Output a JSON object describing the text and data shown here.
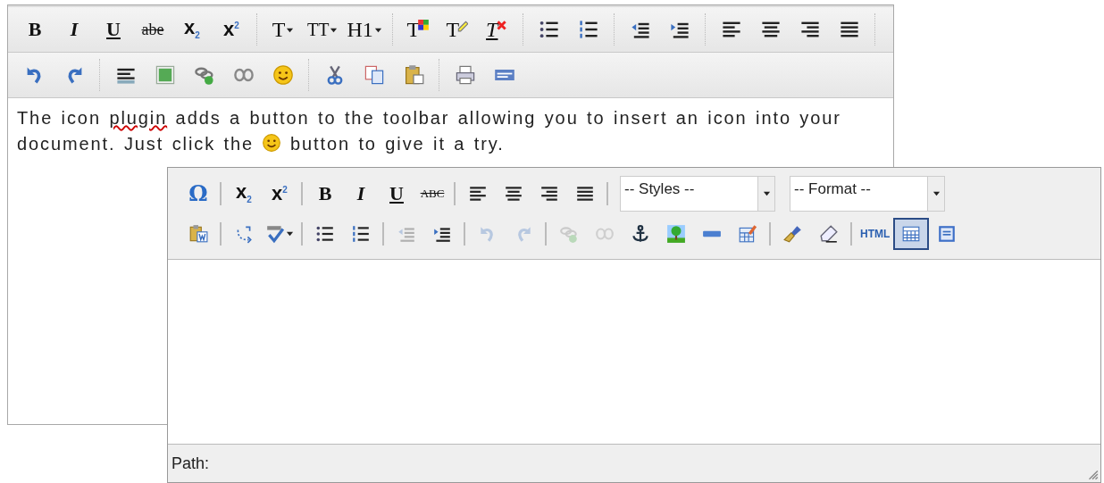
{
  "editor_back": {
    "toolbar_labels": [
      "B",
      "I",
      "U",
      "abe",
      "x$_{2}$",
      "x$^{2}$",
      "T",
      "TT",
      "H1",
      "T",
      "T",
      "T"
    ],
    "content_lines": [
      [
        {
          "kind": "text",
          "text": "The icon "
        },
        {
          "kind": "misspelled",
          "text": "plugin"
        },
        {
          "kind": "text",
          "text": " adds a button to the toolbar allowing you to insert an icon into your"
        }
      ],
      [
        {
          "kind": "text",
          "text": "document. Just click the "
        },
        {
          "kind": "icon"
        },
        {
          "kind": "text",
          "text": " button to give it a try."
        }
      ]
    ]
  },
  "editor_front": {
    "toolbar_labels": [
      "Ω",
      "x$_{2}$",
      "x$^{2}$",
      "B",
      "I",
      "U",
      "ABC",
      "HTML"
    ],
    "selects": [
      {
        "value": "-- Styles --"
      },
      {
        "value": "-- Format --"
      }
    ],
    "second_row_buttons": [
      {
        "disabled": false,
        "active": false
      },
      {
        "disabled": false,
        "active": false
      },
      {
        "disabled": false,
        "active": false
      },
      {
        "disabled": false,
        "active": false
      },
      {
        "disabled": false,
        "active": false
      },
      {
        "disabled": true,
        "active": false
      },
      {
        "disabled": false,
        "active": false
      },
      {
        "disabled": true,
        "active": false
      },
      {
        "disabled": true,
        "active": false
      },
      {
        "disabled": true,
        "active": false
      },
      {
        "disabled": true,
        "active": false
      },
      {
        "disabled": false,
        "active": false
      },
      {
        "disabled": false,
        "active": false
      },
      {
        "disabled": false,
        "active": false
      },
      {
        "disabled": false,
        "active": false
      },
      {
        "disabled": false,
        "active": false
      },
      {
        "disabled": false,
        "active": false
      },
      {
        "disabled": false,
        "active": false
      },
      {
        "disabled": false,
        "active": true
      },
      {
        "disabled": false,
        "active": false
      }
    ],
    "status_bar": {
      "label": "Path:"
    }
  }
}
